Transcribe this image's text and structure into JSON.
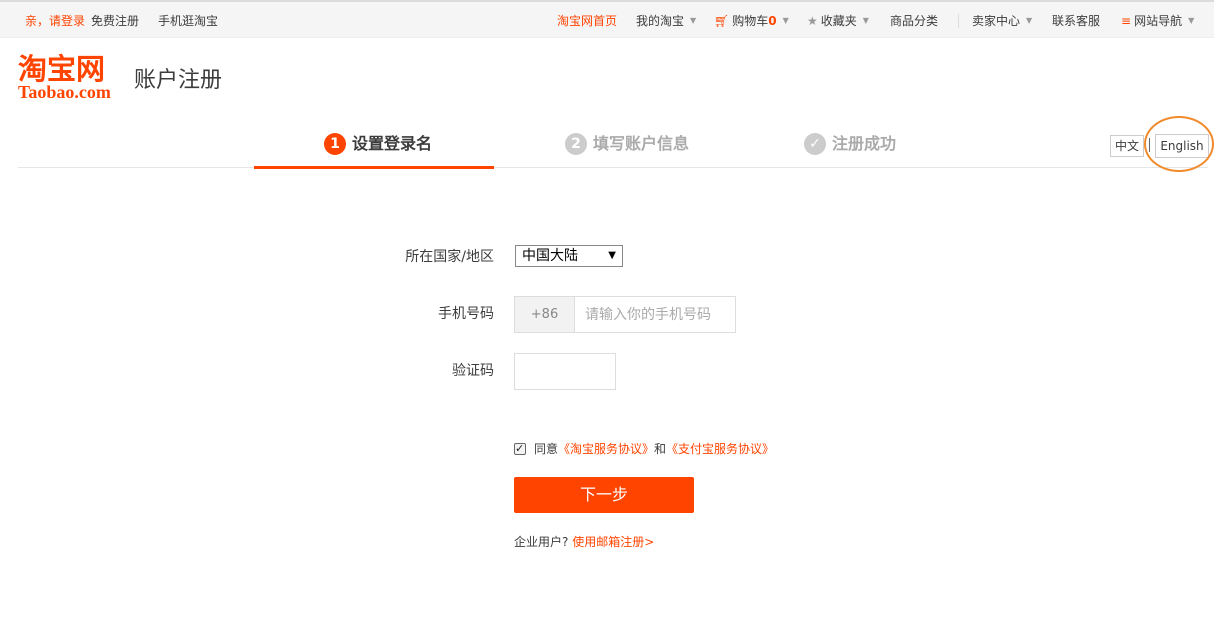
{
  "topbar": {
    "greeting": "亲，请登录",
    "register": "免费注册",
    "mobile": "手机逛淘宝",
    "home": "淘宝网首页",
    "my_taobao": "我的淘宝",
    "cart_label": "购物车",
    "cart_count": "0",
    "favorites": "收藏夹",
    "categories": "商品分类",
    "seller_center": "卖家中心",
    "customer_service": "联系客服",
    "site_nav": "网站导航"
  },
  "header": {
    "logo_cn": "淘宝网",
    "logo_en": "Taobao.com",
    "title": "账户注册"
  },
  "steps": [
    {
      "num": "1",
      "label": "设置登录名"
    },
    {
      "num": "2",
      "label": "填写账户信息"
    },
    {
      "num": "✓",
      "label": "注册成功"
    }
  ],
  "lang": {
    "zh": "中文",
    "en": "English"
  },
  "form": {
    "region_label": "所在国家/地区",
    "region_value": "中国大陆",
    "phone_label": "手机号码",
    "phone_prefix": "+86",
    "phone_placeholder": "请输入你的手机号码",
    "code_label": "验证码",
    "agree_text": "同意",
    "agree_link1": "《淘宝服务协议》",
    "agree_and": "和",
    "agree_link2": "《支付宝服务协议》",
    "next_button": "下一步",
    "enterprise_text": "企业用户?",
    "enterprise_link": "使用邮箱注册>"
  },
  "colors": {
    "accent": "#ff4400",
    "highlight_ring": "#f08a2c"
  }
}
